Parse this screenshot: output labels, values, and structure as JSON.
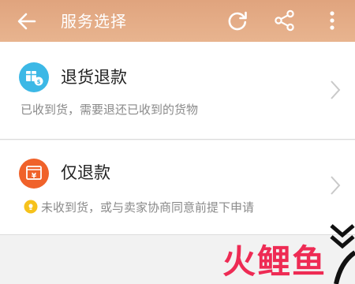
{
  "header": {
    "title": "服务选择",
    "back_icon": "back-arrow-icon",
    "refresh_icon": "refresh-icon",
    "share_icon": "share-icon",
    "more_icon": "more-vertical-icon",
    "background_color": "#e4ab85"
  },
  "options": [
    {
      "title": "退货退款",
      "description": "已收到货，需要退还已收到的货物",
      "icon": "return-goods-icon",
      "icon_color": "#3cb8e6"
    },
    {
      "title": "仅退款",
      "description": "未收到货，或与卖家协商同意前提下申请",
      "icon": "refund-only-icon",
      "icon_color": "#f0622a",
      "tip_icon": "lightbulb-icon"
    }
  ],
  "watermark": {
    "text": "火鲤鱼",
    "color": "#ee2b54"
  }
}
